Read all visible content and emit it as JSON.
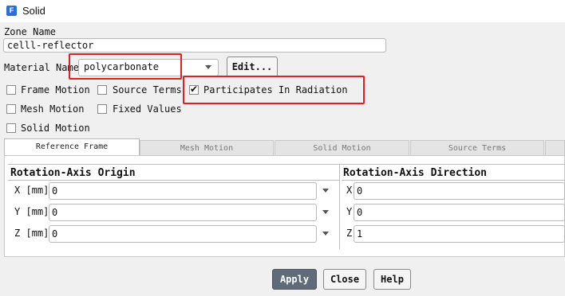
{
  "window": {
    "title": "Solid",
    "app_icon_letter": "F"
  },
  "zone": {
    "label": "Zone Name",
    "value": "celll-reflector"
  },
  "material": {
    "label": "Material Name",
    "value": "polycarbonate",
    "edit_label": "Edit..."
  },
  "checkboxes": {
    "frame_motion": {
      "label": "Frame Motion",
      "checked": false
    },
    "source_terms": {
      "label": "Source Terms",
      "checked": false
    },
    "participates_radiation": {
      "label": "Participates In Radiation",
      "checked": true
    },
    "mesh_motion": {
      "label": "Mesh Motion",
      "checked": false
    },
    "fixed_values": {
      "label": "Fixed Values",
      "checked": false
    },
    "solid_motion": {
      "label": "Solid Motion",
      "checked": false
    }
  },
  "tabs": [
    "Reference Frame",
    "Mesh Motion",
    "Solid Motion",
    "Source Terms"
  ],
  "origin": {
    "title": "Rotation-Axis Origin",
    "rows": [
      {
        "label": "X [mm]",
        "value": "0"
      },
      {
        "label": "Y [mm]",
        "value": "0"
      },
      {
        "label": "Z [mm]",
        "value": "0"
      }
    ]
  },
  "direction": {
    "title": "Rotation-Axis Direction",
    "rows": [
      {
        "label": "X",
        "value": "0"
      },
      {
        "label": "Y",
        "value": "0"
      },
      {
        "label": "Z",
        "value": "1"
      }
    ]
  },
  "buttons": {
    "apply": "Apply",
    "close": "Close",
    "help": "Help"
  },
  "colors": {
    "highlight": "#e02020",
    "apply_bg": "#5f6b78",
    "check_accent": "#111111"
  }
}
